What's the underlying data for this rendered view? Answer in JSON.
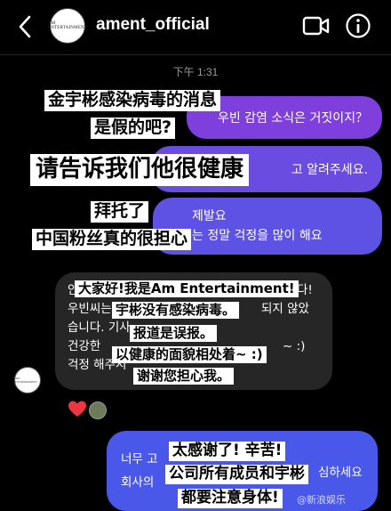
{
  "header": {
    "username": "ament_official",
    "avatar_brand": "AM ENTERTAINMENT",
    "icons": [
      "back-arrow-icon",
      "video-call-icon",
      "info-icon"
    ]
  },
  "chat": {
    "timestamp": "下午 1:31",
    "outgoing": [
      {
        "text": "우빈 감염 소식은 거짓이지？"
      },
      {
        "text": "고 알려주세요."
      },
      {
        "line1": "제발요",
        "line2": "는 정말 걱정을 많이 해요"
      },
      {
        "line1": "너무 고",
        "line2": "회사의",
        "tail": "심하세요"
      }
    ],
    "incoming": {
      "lines": [
        "안",
        "우빈씨는",
        "습니다. 기사",
        "건강한",
        "걱정 해주시"
      ],
      "right_fragments": [
        "다!",
        "되지 않았",
        "~ :)"
      ]
    },
    "reactions": [
      "heart-reaction",
      "user-avatar-reaction"
    ],
    "colors": {
      "outgoing_1": "#7e3fdc",
      "outgoing_2": "#6a4ce0",
      "outgoing_3": "#5e52e4",
      "outgoing_4": "#4a58ea",
      "incoming": "#262626"
    }
  },
  "captions": [
    "金宇彬感染病毒的消息",
    "是假的吧?",
    "请告诉我们他很健康",
    "拜托了",
    "中国粉丝真的很担心",
    "大家好!我是Am Entertainment!",
    "宇彬没有感染病毒。",
    "报道是误报。",
    "以健康的面貌相处着~ :)",
    "谢谢您担心我。",
    "太感谢了! 辛苦!",
    "公司所有成员和宇彬",
    "都要注意身体!"
  ],
  "watermark": "@新浪娱乐"
}
